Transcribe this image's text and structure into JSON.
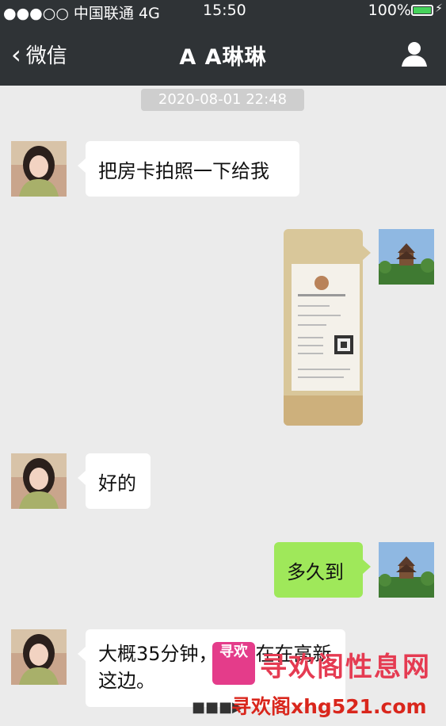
{
  "status_bar": {
    "carrier": "●●●○○ 中国联通",
    "network": "4G",
    "time": "15:50",
    "battery": "100%",
    "battery_level": 1.0
  },
  "nav": {
    "back_label": "微信",
    "title": "A A琳琳"
  },
  "timestamp": "2020-08-01 22:48",
  "messages": [
    {
      "from": "left",
      "text": "把房卡拍照一下给我"
    },
    {
      "from": "right",
      "type": "image"
    },
    {
      "from": "left",
      "text": "好的"
    },
    {
      "from": "right",
      "text": "多久到"
    },
    {
      "from": "left",
      "text": "大概35分钟，我现在在高新这边。"
    }
  ],
  "watermark": {
    "logo_text": "寻欢",
    "title": "寻欢阁性息网",
    "url": "寻欢阁xhg521.com"
  },
  "colors": {
    "header_bg": "#2f3336",
    "chat_bg": "#ebebeb",
    "bubble_self": "#9fe85a",
    "bubble_other": "#ffffff"
  }
}
